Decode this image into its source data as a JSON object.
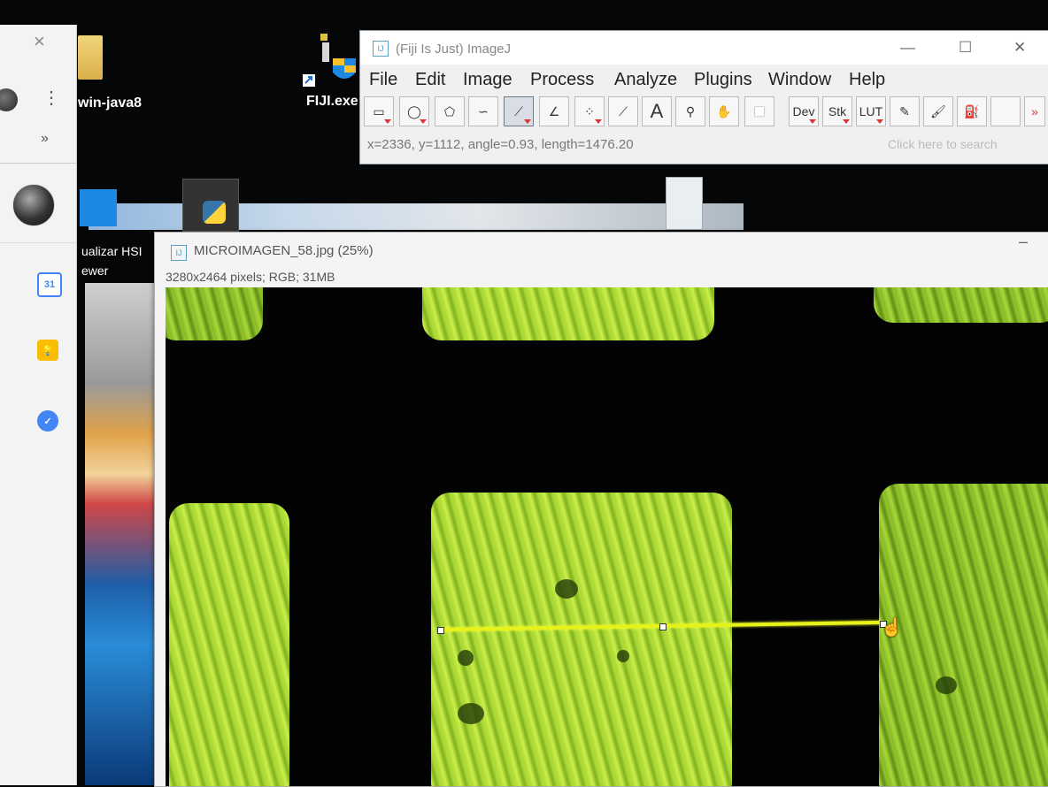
{
  "desktop": {
    "icons": [
      {
        "label": "win-java8"
      },
      {
        "label": "FIJI.exe"
      },
      {
        "label_line1": "ualizar HSI",
        "label_line2": "ewer"
      }
    ]
  },
  "browser_panel": {
    "close": "×",
    "kebab": "⋮",
    "chevron": "»",
    "calendar_day": "31"
  },
  "imagej": {
    "title": "(Fiji Is Just) ImageJ",
    "logo": "IJ",
    "menu": [
      "File",
      "Edit",
      "Image",
      "Process",
      "Analyze",
      "Plugins",
      "Window",
      "Help"
    ],
    "tools": {
      "rectangle": "▭",
      "oval": "◯",
      "polygon": "⬠",
      "freehand": "∽",
      "line": "⟋",
      "angle": "∠",
      "multipoint": "⁘",
      "wand": "⟋",
      "text": "A",
      "magnifier": "⚲",
      "hand": "✋",
      "dropper": "■",
      "dev": "Dev",
      "stk": "Stk",
      "lut": "LUT",
      "pencil": "✎",
      "brush": "🖌",
      "fill": "⛽",
      "more": "»"
    },
    "status": "x=2336, y=1112, angle=0.93, length=1476.20",
    "search_placeholder": "Click here to search"
  },
  "image_window": {
    "title": "MICROIMAGEN_58.jpg (25%)",
    "info": "3280x2464 pixels; RGB; 31MB",
    "minimize": "–",
    "line_angle_deg": 0.93
  },
  "colors": {
    "selection_line": "#e7f21a",
    "tissue_green": "#a8d630"
  }
}
